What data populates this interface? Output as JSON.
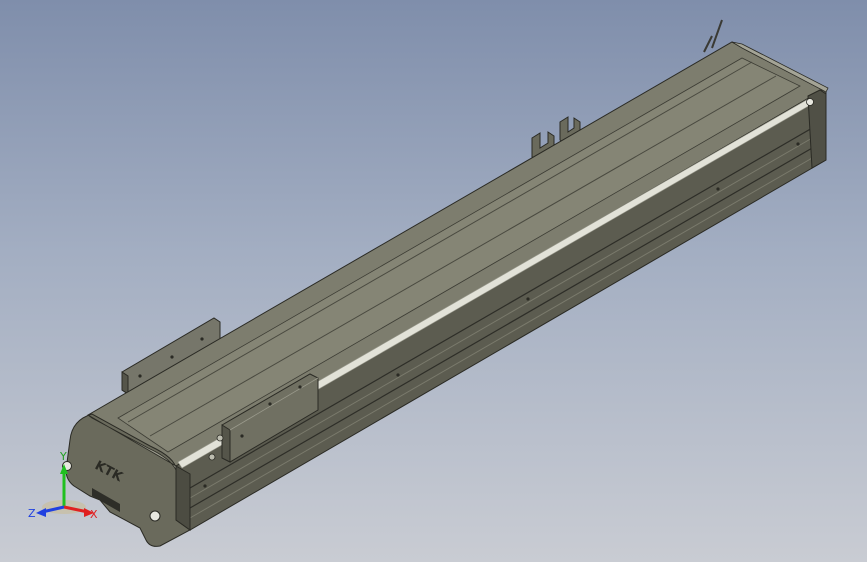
{
  "model": {
    "logo_text": "KTK"
  },
  "triad": {
    "x_label": "X",
    "y_label": "Y",
    "z_label": "Z",
    "x_color": "#e02020",
    "y_color": "#20c020",
    "z_color": "#2040e0"
  },
  "colors": {
    "body_top": "#7c7c6c",
    "body_side": "#5e5e52",
    "body_dark": "#3f3f36",
    "edge": "#2a2a24",
    "highlight": "#dcdcd0",
    "rail": "#e8e8e0"
  }
}
